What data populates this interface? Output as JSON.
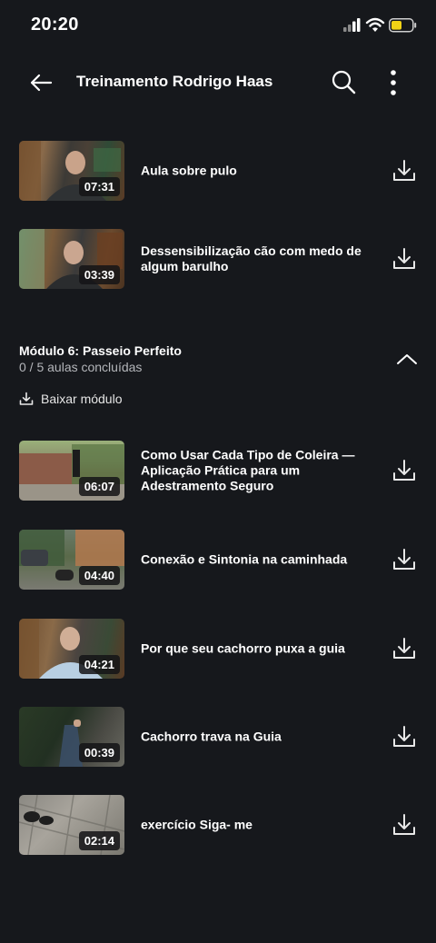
{
  "status_bar": {
    "time": "20:20",
    "icons": [
      "signal-icon",
      "wifi-icon",
      "battery-icon"
    ],
    "battery_color": "#f2d316"
  },
  "app_bar": {
    "title": "Treinamento Rodrigo Haas",
    "icons": [
      "back-arrow-icon",
      "search-icon",
      "more-vertical-icon"
    ]
  },
  "lessons_before": [
    {
      "title": "Aula sobre pulo",
      "duration": "07:31"
    },
    {
      "title": "Dessensibilização cão com medo de algum barulho",
      "duration": "03:39"
    }
  ],
  "module": {
    "title": "Módulo 6: Passeio Perfeito",
    "progress": "0 / 5 aulas concluídas",
    "download_label": "Baixar módulo",
    "lessons": [
      {
        "title": "Como Usar Cada Tipo de Coleira — Aplicação Prática para um Adestramento Seguro",
        "duration": "06:07"
      },
      {
        "title": "Conexão e Sintonia na caminhada",
        "duration": "04:40"
      },
      {
        "title": "Por que seu cachorro puxa a guia",
        "duration": "04:21"
      },
      {
        "title": "Cachorro trava na Guia",
        "duration": "00:39"
      },
      {
        "title": "exercício Siga- me",
        "duration": "02:14"
      }
    ]
  },
  "colors": {
    "background": "#16181c",
    "text_primary": "#ffffff",
    "text_secondary": "#b4b6ba"
  }
}
